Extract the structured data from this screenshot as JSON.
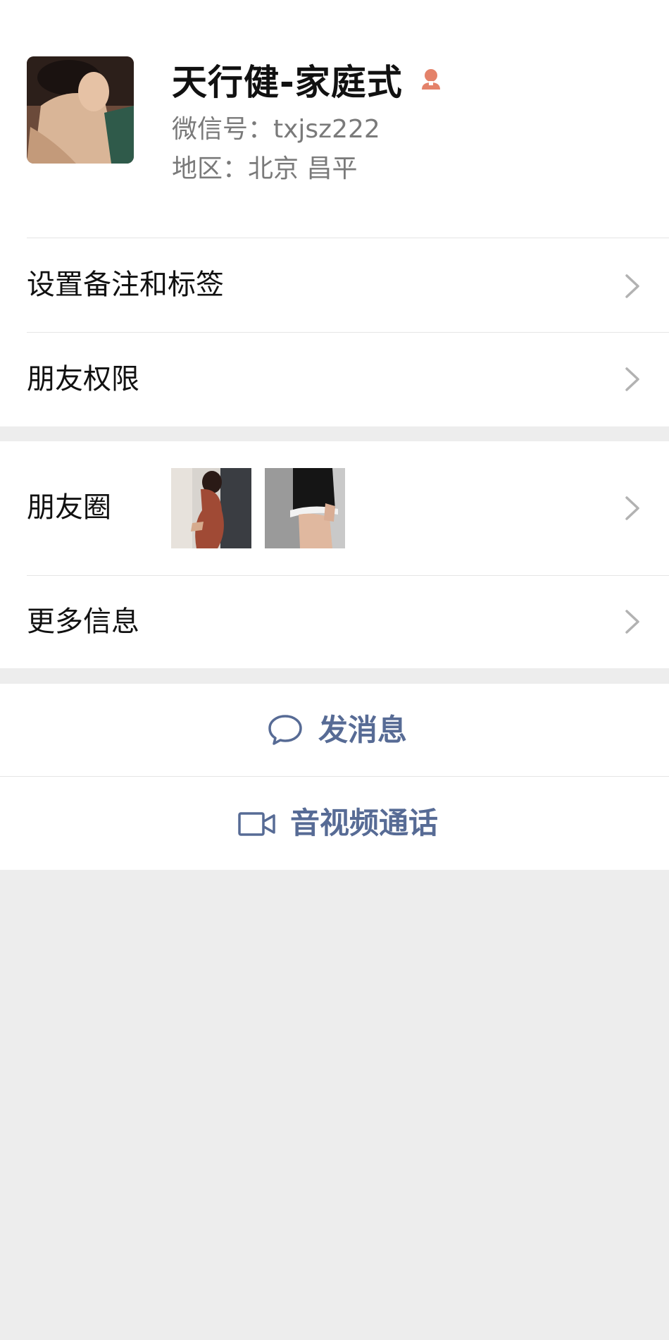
{
  "contact": {
    "name": "天行健-家庭式",
    "wechat_id_line": "微信号：txjsz222",
    "region_line": "地区：北京  昌平"
  },
  "menu": {
    "remark_tags": "设置备注和标签",
    "friend_permissions": "朋友权限",
    "moments": "朋友圈",
    "more_info": "更多信息"
  },
  "actions": {
    "send_message": "发消息",
    "video_call": "音视频通话"
  },
  "icons": {
    "back": "back-arrow-icon",
    "gender": "female-icon",
    "chevron": "chevron-right-icon",
    "chat": "chat-bubble-icon",
    "video": "video-camera-icon"
  },
  "colors": {
    "link_blue": "#576b95",
    "gender_female": "#e4826a",
    "background": "#ededed"
  }
}
